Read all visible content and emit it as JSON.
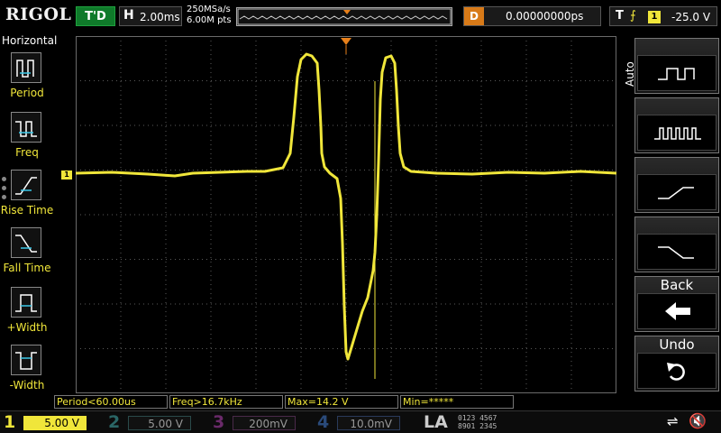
{
  "header": {
    "brand": "RIGOL",
    "run_state": "T'D",
    "horizontal": {
      "label": "H",
      "timebase": "2.00ms"
    },
    "sample_rate": "250MSa/s",
    "memory_depth": "6.00M pts",
    "delay": {
      "label": "D",
      "value": "0.00000000ps"
    },
    "trigger": {
      "label": "T",
      "source": "1",
      "level": "-25.0 V"
    }
  },
  "left_panel": {
    "title": "Horizontal",
    "items": [
      {
        "label": "Period",
        "icon": "period-icon"
      },
      {
        "label": "Freq",
        "icon": "freq-icon"
      },
      {
        "label": "Rise Time",
        "icon": "rise-time-icon"
      },
      {
        "label": "Fall Time",
        "icon": "fall-time-icon"
      },
      {
        "label": "+Width",
        "icon": "positive-width-icon"
      },
      {
        "label": "-Width",
        "icon": "negative-width-icon"
      }
    ]
  },
  "right_panel": {
    "mode": "Auto",
    "buttons": [
      {
        "label": "",
        "icon": "single-pulse-icon"
      },
      {
        "label": "",
        "icon": "pulse-train-icon"
      },
      {
        "label": "",
        "icon": "rising-edge-icon"
      },
      {
        "label": "",
        "icon": "falling-edge-icon"
      },
      {
        "label": "Back",
        "icon": "back-arrow-icon"
      },
      {
        "label": "Undo",
        "icon": "undo-icon"
      }
    ]
  },
  "measurements": [
    {
      "text": "Period<60.00us"
    },
    {
      "text": "Freq>16.7kHz"
    },
    {
      "text": "Max=14.2 V"
    },
    {
      "text": "Min=*****"
    }
  ],
  "channels": [
    {
      "number": "1",
      "scale": "5.00 V",
      "color": "#f0e63a",
      "active": true
    },
    {
      "number": "2",
      "scale": "5.00 V",
      "color": "#29c6c6",
      "active": false
    },
    {
      "number": "3",
      "scale": "200mV",
      "color": "#d63ad6",
      "active": false
    },
    {
      "number": "4",
      "scale": "10.0mV",
      "color": "#3a7ad6",
      "active": false
    }
  ],
  "la": {
    "label": "LA",
    "bits_top": "0123 4567",
    "bits_bottom": "8901 2345"
  },
  "colors": {
    "trace": "#f0e63a",
    "trigger_marker": "#e8801a",
    "grid": "#5a5a5a"
  }
}
